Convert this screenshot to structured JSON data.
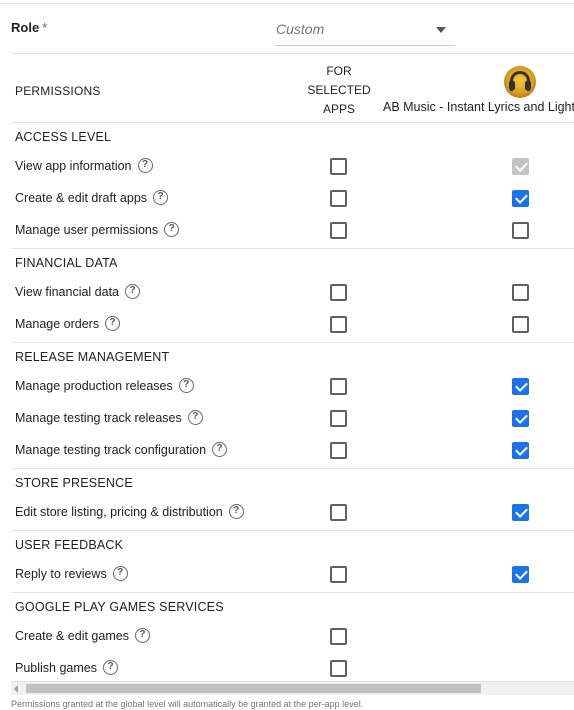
{
  "role": {
    "label": "Role",
    "required_marker": "*",
    "value": "Custom"
  },
  "columns": {
    "permissions": "PERMISSIONS",
    "selected_apps": [
      "FOR",
      "SELECTED",
      "APPS"
    ],
    "app_name": "AB Music - Instant Lyrics and Light"
  },
  "sections": [
    {
      "title": "ACCESS LEVEL",
      "rows": [
        {
          "label": "View app information",
          "selected": false,
          "app": "disabled-checked"
        },
        {
          "label": "Create & edit draft apps",
          "selected": false,
          "app": "checked"
        },
        {
          "label": "Manage user permissions",
          "selected": false,
          "app": "unchecked"
        }
      ]
    },
    {
      "title": "FINANCIAL DATA",
      "rows": [
        {
          "label": "View financial data",
          "selected": false,
          "app": "unchecked"
        },
        {
          "label": "Manage orders",
          "selected": false,
          "app": "unchecked"
        }
      ]
    },
    {
      "title": "RELEASE MANAGEMENT",
      "rows": [
        {
          "label": "Manage production releases",
          "selected": false,
          "app": "checked"
        },
        {
          "label": "Manage testing track releases",
          "selected": false,
          "app": "checked"
        },
        {
          "label": "Manage testing track configuration",
          "selected": false,
          "app": "checked"
        }
      ]
    },
    {
      "title": "STORE PRESENCE",
      "rows": [
        {
          "label": "Edit store listing, pricing & distribution",
          "selected": false,
          "app": "checked"
        }
      ]
    },
    {
      "title": "USER FEEDBACK",
      "rows": [
        {
          "label": "Reply to reviews",
          "selected": false,
          "app": "checked"
        }
      ]
    },
    {
      "title": "GOOGLE PLAY GAMES SERVICES",
      "rows": [
        {
          "label": "Create & edit games",
          "selected": false,
          "app": "none"
        },
        {
          "label": "Publish games",
          "selected": false,
          "app": "none"
        }
      ]
    }
  ],
  "help_glyph": "?",
  "footnote": "Permissions granted at the global level will automatically be granted at the per-app level.",
  "colors": {
    "accent": "#1a73e8",
    "disabled": "#c4c4c4",
    "divider": "#e6e6e6"
  },
  "icons": {
    "app": "headphones-app-icon",
    "help": "help-circle-icon",
    "dropdown": "dropdown-arrow-icon",
    "scroll": "scroll-left-arrow-icon"
  }
}
